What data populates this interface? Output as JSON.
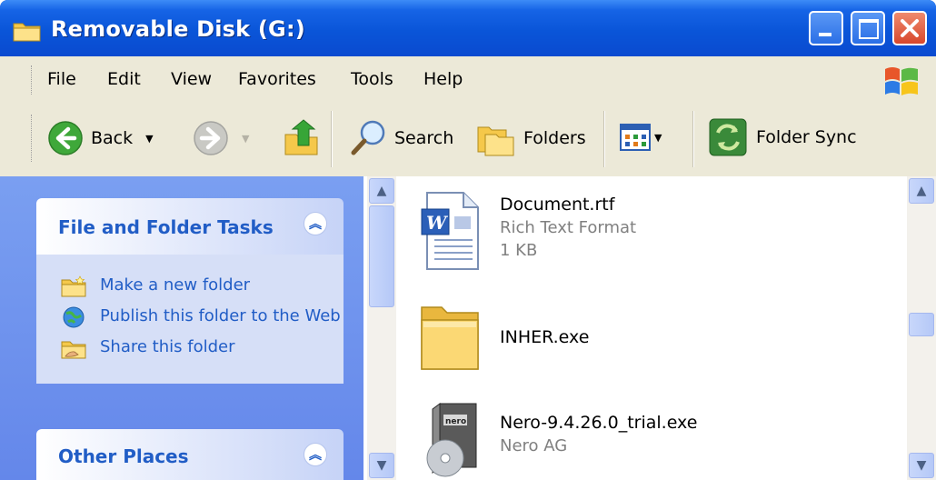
{
  "window": {
    "title": "Removable Disk (G:)"
  },
  "menu": {
    "items": [
      "File",
      "Edit",
      "View",
      "Favorites",
      "Tools",
      "Help"
    ]
  },
  "toolbar": {
    "back_label": "Back",
    "search_label": "Search",
    "folders_label": "Folders",
    "folder_sync_label": "Folder Sync"
  },
  "sidebar": {
    "file_tasks": {
      "title": "File and Folder Tasks",
      "items": [
        {
          "label": "Make a new folder",
          "icon": "new-folder-icon"
        },
        {
          "label": "Publish this folder to the Web",
          "icon": "publish-web-icon"
        },
        {
          "label": "Share this folder",
          "icon": "share-folder-icon"
        }
      ]
    },
    "other_places": {
      "title": "Other Places"
    }
  },
  "files": [
    {
      "name": "Document.rtf",
      "type": "Rich Text Format",
      "size": "1 KB",
      "icon": "word-document-icon"
    },
    {
      "name": "INHER.exe",
      "icon": "folder-icon"
    },
    {
      "name": "Nero-9.4.26.0_trial.exe",
      "company": "Nero AG",
      "icon": "nero-setup-icon"
    }
  ],
  "colors": {
    "titlebar": "#0a55d8",
    "sidebar_bg": "#6f93ee",
    "panel_title": "#215dc6",
    "toolbar_bg": "#ece9d8"
  }
}
